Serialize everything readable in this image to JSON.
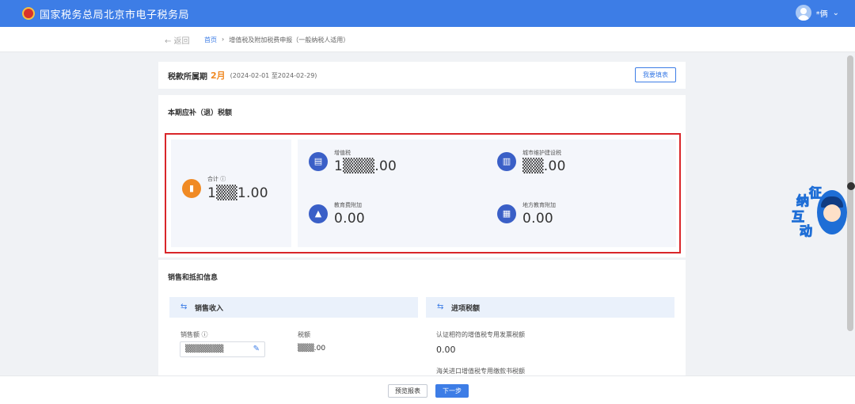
{
  "header": {
    "title": "国家税务总局北京市电子税务局",
    "user_name": "*俩",
    "dropdown_icon": "chevron-down-icon"
  },
  "breadcrumb": {
    "back_label": "← 返回",
    "home": "首页",
    "separator": "›",
    "current": "增值税及附加税费申报（一般纳税人适用）"
  },
  "period": {
    "label": "税款所属期",
    "month": "2月",
    "range": "(2024-02-01 至2024-02-29)",
    "button": "我要填表"
  },
  "tax_section": {
    "title": "本期应补（退）税额",
    "total": {
      "label": "合计 ⓘ",
      "value": "1▒▒1.00"
    },
    "items": [
      {
        "label": "增值税",
        "value": "1▒▒▒.00",
        "icon": "invoice-icon"
      },
      {
        "label": "城市维护建设税",
        "value": "▒▒.00",
        "icon": "building-icon"
      },
      {
        "label": "教育费附加",
        "value": "0.00",
        "icon": "graduation-cap-icon"
      },
      {
        "label": "地方教育附加",
        "value": "0.00",
        "icon": "book-icon"
      }
    ]
  },
  "sales_section": {
    "title": "销售和抵扣信息",
    "sales": {
      "title": "销售收入",
      "revenue_label": "销售额 ⓘ",
      "revenue_value": "▒▒▒▒▒▒▒",
      "tax_label": "税额",
      "tax_value": "▒▒▒.00"
    },
    "input": {
      "title": "进项税额",
      "item1_label": "认证相符的增值税专用发票税额",
      "item1_value": "0.00",
      "item2_label": "海关进口增值税专用缴款书税额"
    }
  },
  "footer": {
    "preview_button": "预览报表",
    "next_button": "下一步"
  },
  "mascot": {
    "chars": [
      "征",
      "纳",
      "互",
      "动"
    ]
  },
  "colors": {
    "primary": "#3d7de6",
    "accent": "#f08a24",
    "highlight_border": "#d9262a",
    "icon_blue": "#3a5fc7"
  }
}
